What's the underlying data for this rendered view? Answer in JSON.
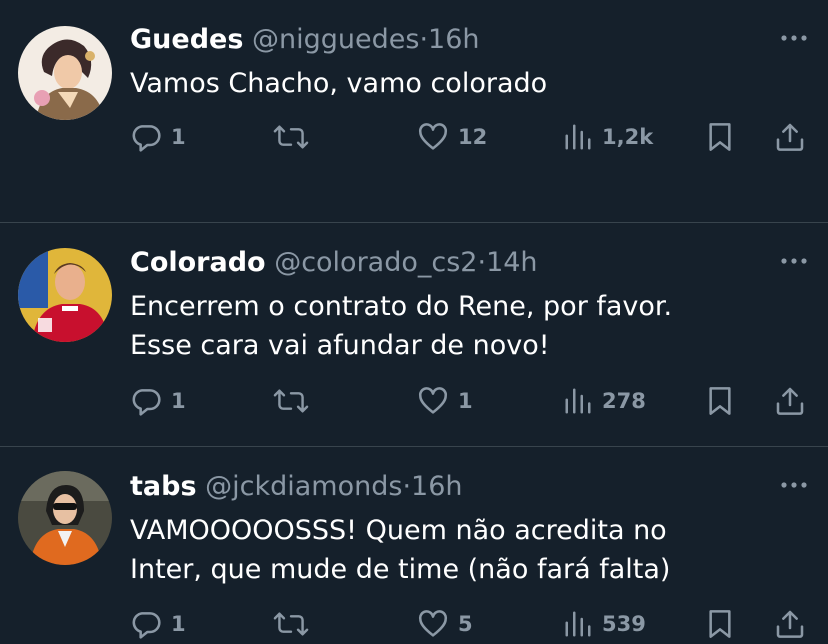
{
  "tweets": [
    {
      "name": "Guedes",
      "handle": "@nigguedes",
      "separator": "·",
      "time": "16h",
      "text_lines": [
        "Vamos Chacho, vamo colorado"
      ],
      "replies": "1",
      "retweets": "",
      "likes": "12",
      "views": "1,2k",
      "avatar_colors": {
        "bg": "#f3ece4",
        "hair": "#3b2a2a",
        "skin": "#f0c9a8",
        "coat": "#8a6a4a"
      }
    },
    {
      "name": "Colorado",
      "handle": "@colorado_cs2",
      "separator": "·",
      "time": "14h",
      "text_lines": [
        "Encerrem o contrato do Rene, por favor.",
        "Esse cara vai afundar de novo!"
      ],
      "replies": "1",
      "retweets": "",
      "likes": "1",
      "views": "278",
      "avatar_colors": {
        "bg": "#e0b63a",
        "shirt": "#c8102e",
        "skin": "#e9b08d",
        "hair": "#5a3a22"
      }
    },
    {
      "name": "tabs",
      "handle": "@jckdiamonds",
      "separator": "·",
      "time": "16h",
      "text_lines": [
        "VAMOOOOOSSS! Quem não acredita no",
        "Inter, que mude de time (não fará falta)"
      ],
      "replies": "1",
      "retweets": "",
      "likes": "5",
      "views": "539",
      "avatar_colors": {
        "bg": "#4a4a40",
        "jacket": "#e06a1f",
        "skin": "#e7c0a2",
        "hair": "#1c1c1c"
      }
    }
  ],
  "icons": {
    "reply": "reply-icon",
    "retweet": "retweet-icon",
    "like": "heart-icon",
    "views": "views-icon",
    "bookmark": "bookmark-icon",
    "share": "share-icon",
    "more": "more-icon"
  },
  "colors": {
    "background": "#15202b",
    "divider": "#38444d",
    "muted": "#8b98a5",
    "text": "#ffffff"
  }
}
